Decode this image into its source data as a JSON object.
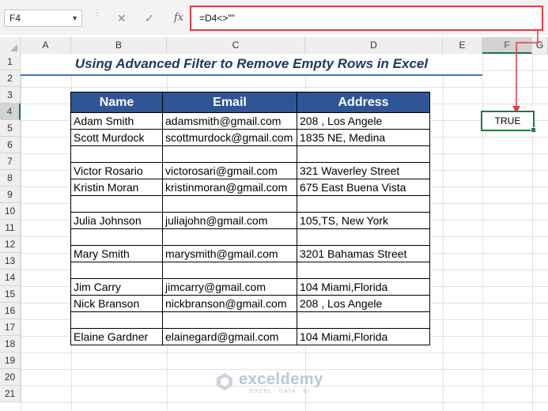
{
  "formula_bar": {
    "name_box": "F4",
    "cancel_icon": "✕",
    "enter_icon": "✓",
    "fx_label": "fx",
    "formula": "=D4<>\"\""
  },
  "columns": [
    "A",
    "B",
    "C",
    "D",
    "E",
    "F",
    "G"
  ],
  "active_column": "F",
  "rows": [
    "1",
    "2",
    "3",
    "4",
    "5",
    "6",
    "7",
    "8",
    "9",
    "10",
    "11",
    "12",
    "13",
    "14",
    "15",
    "16",
    "17",
    "18",
    "19",
    "20",
    "21"
  ],
  "active_row": "4",
  "title": "Using Advanced Filter to Remove Empty Rows in Excel",
  "table": {
    "headers": [
      "Name",
      "Email",
      "Address"
    ],
    "rows": [
      [
        "Adam Smith",
        "adamsmith@gmail.com",
        "208 , Los Angele"
      ],
      [
        "Scott Murdock",
        "scottmurdock@gmail.com",
        "1835  NE, Medina"
      ],
      [
        "",
        "",
        ""
      ],
      [
        "Victor Rosario",
        "victorosari@gmail.com",
        "321 Waverley Street"
      ],
      [
        "Kristin Moran",
        "kristinmoran@gmail.com",
        "675 East Buena Vista"
      ],
      [
        "",
        "",
        ""
      ],
      [
        "Julia Johnson",
        "juliajohn@gmail.com",
        "105,TS, New York"
      ],
      [
        "",
        "",
        ""
      ],
      [
        "Mary Smith",
        "marysmith@gmail.com",
        "3201 Bahamas Street"
      ],
      [
        "",
        "",
        ""
      ],
      [
        "Jim Carry",
        "jimcarry@gmail.com",
        "104 Miami,Florida"
      ],
      [
        "Nick Branson",
        "nickbranson@gmail.com",
        "208 , Los Angele"
      ],
      [
        "",
        "",
        ""
      ],
      [
        "Elaine Gardner",
        "elainegard@gmail.com",
        "104 Miami,Florida"
      ]
    ]
  },
  "active_cell_value": "TRUE",
  "watermark": {
    "name": "exceldemy",
    "tagline": "EXCEL · DATA · BI"
  },
  "colors": {
    "header_fill": "#2f5597",
    "title_color": "#1f3864",
    "highlight_red": "#e03c45",
    "selection_green": "#1e7a45"
  }
}
